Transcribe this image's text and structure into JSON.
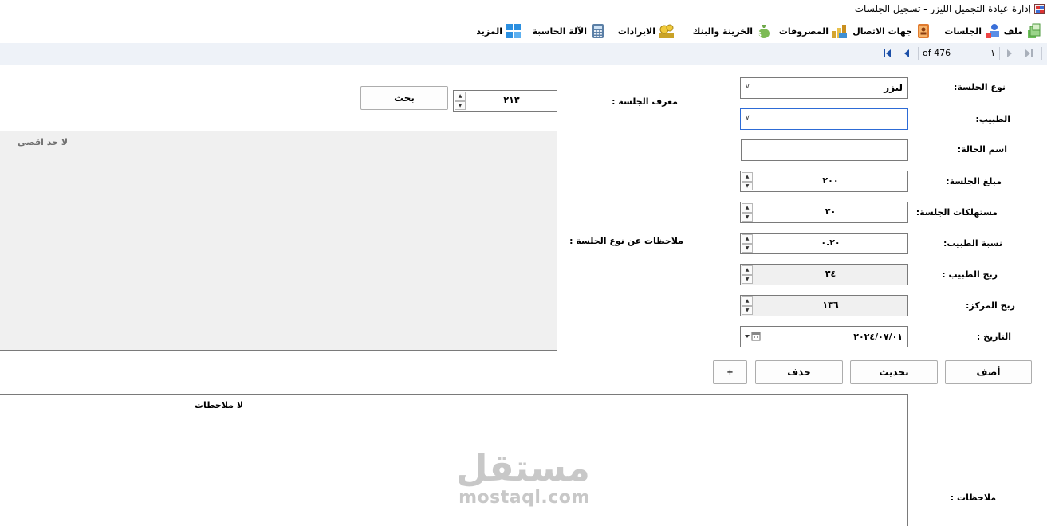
{
  "window": {
    "title": "إدارة عيادة التجميل الليزر - تسجيل الجلسات"
  },
  "menu": [
    {
      "label": "ملف",
      "icon": "file-icon"
    },
    {
      "label": "الجلسات",
      "icon": "sessions-icon"
    },
    {
      "label": "جهات الاتصال",
      "icon": "contacts-icon"
    },
    {
      "label": "المصروفات",
      "icon": "expenses-icon"
    },
    {
      "label": "الخزينة والبنك",
      "icon": "treasury-icon"
    },
    {
      "label": "الايرادات",
      "icon": "revenue-icon"
    },
    {
      "label": "الآلة الحاسبة",
      "icon": "calculator-icon"
    },
    {
      "label": "المزيد",
      "icon": "more-icon"
    }
  ],
  "navigator": {
    "position": "١",
    "of_label": "of 476"
  },
  "form": {
    "session_type": {
      "label": "نوع الجلسة:",
      "value": "ليزر"
    },
    "doctor": {
      "label": "الطبيب:",
      "value": ""
    },
    "case_name": {
      "label": "اسم الحالة:",
      "value": ""
    },
    "session_amount": {
      "label": "مبلغ الجلسة:",
      "value": "٢٠٠"
    },
    "session_supplies": {
      "label": "مستهلكات الجلسة:",
      "value": "٣٠"
    },
    "doctor_ratio": {
      "label": "نسبة الطبيب:",
      "value": "٠.٢٠"
    },
    "doctor_profit": {
      "label": "ربح الطبيب :",
      "value": "٣٤"
    },
    "center_profit": {
      "label": "ربح المركز:",
      "value": "١٣٦"
    },
    "date": {
      "label": "التاريخ :",
      "value": "٢٠٢٤/٠٧/٠١"
    },
    "session_id": {
      "label": "معرف الجلسة :",
      "value": "٢١٣"
    },
    "search_button": "بحث",
    "type_notes": {
      "label": "ملاحظات عن نوع الجلسة :",
      "value": "لا حد اقصى"
    },
    "notes": {
      "label": "ملاحظات :",
      "value": "لا ملاحظات"
    }
  },
  "actions": {
    "add": "أضف",
    "update": "تحديث",
    "delete": "حذف",
    "extra": "+"
  },
  "watermark": {
    "arabic": "مستقل",
    "latin": "mostaql.com"
  },
  "colors": {
    "navbar_bg": "#eef2f8",
    "nav_arrow": "#1b4fa8",
    "readonly_bg": "#f0f0f0",
    "memo_bg": "#f0f0f0"
  }
}
